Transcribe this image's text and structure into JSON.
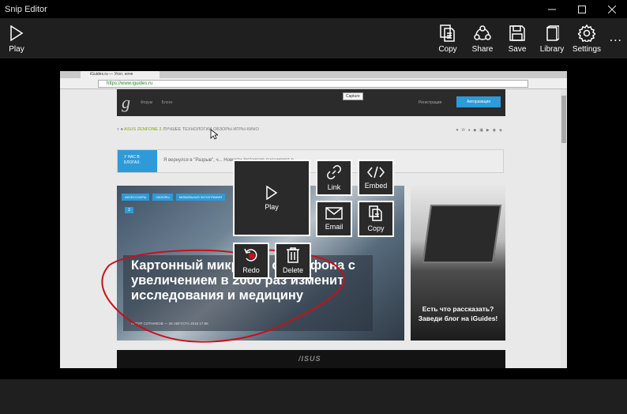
{
  "window": {
    "title": "Snip Editor"
  },
  "toolbar": {
    "play": {
      "label": "Play",
      "icon": "play-icon"
    },
    "copy": {
      "label": "Copy",
      "icon": "copy-icon"
    },
    "share": {
      "label": "Share",
      "icon": "share-icon"
    },
    "save": {
      "label": "Save",
      "icon": "save-icon"
    },
    "library": {
      "label": "Library",
      "icon": "library-icon"
    },
    "settings": {
      "label": "Settings",
      "icon": "gear-icon"
    },
    "more": "..."
  },
  "captured_page": {
    "tab_title": "iGuides.ru — Угол. ноче",
    "url": "https://www.iguides.ru",
    "logo": "g",
    "nav": [
      "Форум",
      "Блоги"
    ],
    "register": "Регистрация",
    "auth_button": "Авторизация",
    "capture_tooltip": "Capture",
    "menu": {
      "highlight": "ASUS ZENFONE 2",
      "items": "ЛУЧШЕЕ ТЕХНОЛОГИИ ОБЗОРЫ ИГРЫ КИНО"
    },
    "blog_label": "У НАС В БЛОГАХ:",
    "blog_text": "Я вернулся в \"Разрыв\", ч... Новости Instagram расширяет р...",
    "hero_tags": [
      "АКСЕССУАРЫ",
      "ОБЗОРЫ",
      "МОБИЛЬНАЯ ФОТОГРАФИЯ"
    ],
    "hero_comments": "3",
    "hero_title": "Картонный микроско смартфона с увеличением в 2000 раз изменит исследования и медицину",
    "hero_author": "АРТУР СОТНИКОВ — 26 АВГУСТА 2016 17:55",
    "ad_text": "Есть что рассказать? Заведи блог на iGuides!",
    "asus": "/ISUS"
  },
  "context_menu": {
    "play": "Play",
    "link": "Link",
    "embed": "Embed",
    "email": "Email",
    "copy": "Copy",
    "redo": "Redo",
    "delete": "Delete"
  },
  "colors": {
    "accent": "#2e9ad8",
    "ink": "#c8101a",
    "toolbar": "#1f1f1f"
  }
}
